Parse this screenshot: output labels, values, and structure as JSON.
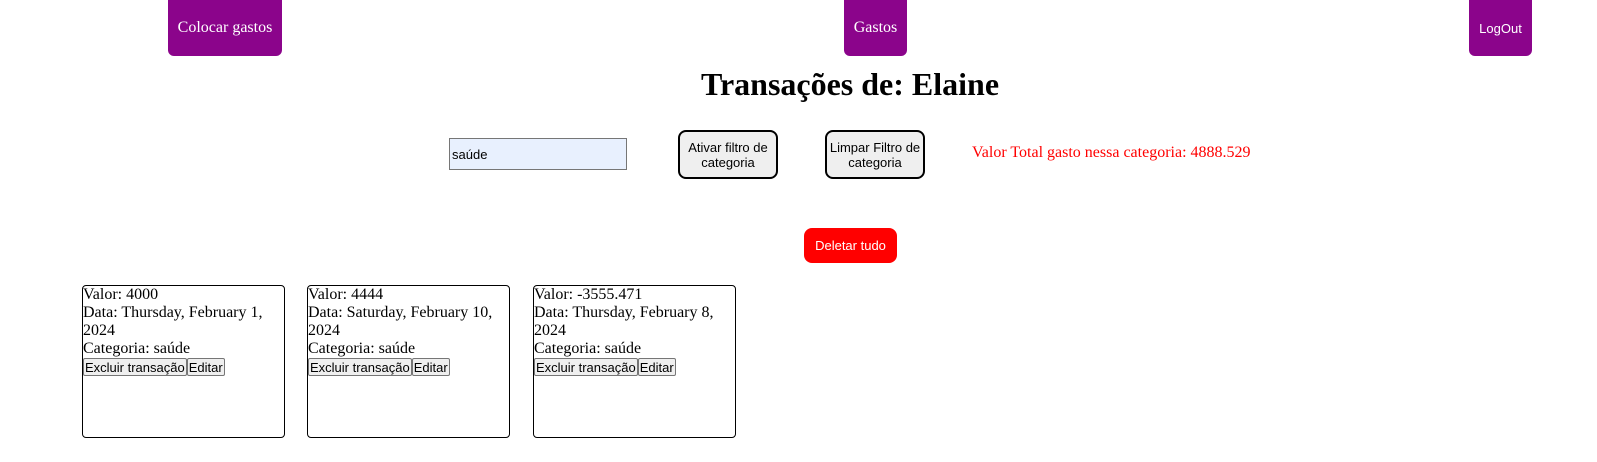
{
  "nav": {
    "colocar_gastos": "Colocar gastos",
    "gastos": "Gastos",
    "logout": "LogOut"
  },
  "title": "Transações de: Elaine",
  "filter": {
    "input_value": "saúde",
    "activate_label": "Ativar filtro de categoria",
    "clear_label": "Limpar Filtro de categoria",
    "total_text": "Valor Total gasto nessa categoria: 4888.529"
  },
  "delete_all_label": "Deletar tudo",
  "transactions": [
    {
      "valor": "Valor: 4000",
      "data": "Data: Thursday, February 1, 2024",
      "categoria": "Categoria: saúde",
      "delete_label": "Excluir transação",
      "edit_label": "Editar"
    },
    {
      "valor": "Valor: 4444",
      "data": "Data: Saturday, February 10, 2024",
      "categoria": "Categoria: saúde",
      "delete_label": "Excluir transação",
      "edit_label": "Editar"
    },
    {
      "valor": "Valor: -3555.471",
      "data": "Data: Thursday, February 8, 2024",
      "categoria": "Categoria: saúde",
      "delete_label": "Excluir transação",
      "edit_label": "Editar"
    }
  ],
  "colors": {
    "nav_bg": "#8b048b",
    "total_text": "#ff0000",
    "delete_all_bg": "#ff0000"
  }
}
